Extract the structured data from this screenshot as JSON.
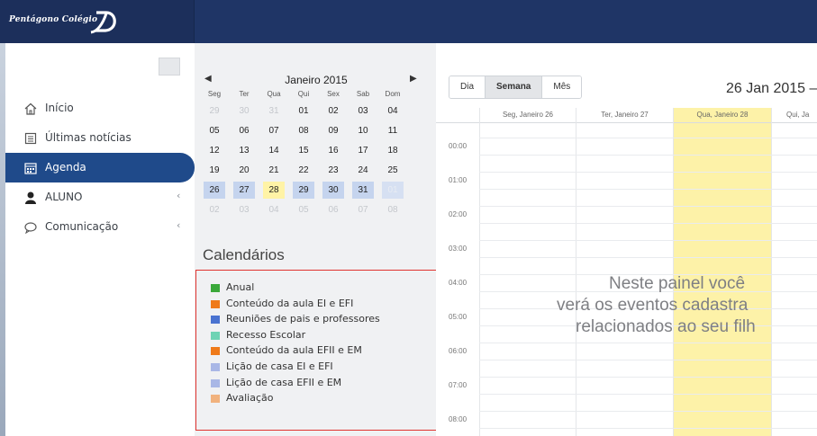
{
  "brand": {
    "name": "Pentágono Colégio"
  },
  "sidebar": {
    "items": [
      {
        "label": "Início",
        "icon": "home-icon",
        "active": false,
        "chevron": ""
      },
      {
        "label": "Últimas notícias",
        "icon": "news-icon",
        "active": false,
        "chevron": ""
      },
      {
        "label": "Agenda",
        "icon": "calendar-icon",
        "active": true,
        "chevron": ""
      },
      {
        "label": "ALUNO",
        "icon": "user-icon",
        "active": false,
        "chevron": "‹"
      },
      {
        "label": "Comunicação",
        "icon": "chat-icon",
        "active": false,
        "chevron": "‹"
      }
    ]
  },
  "mini_calendar": {
    "prev": "◀",
    "next": "▶",
    "title": "Janeiro 2015",
    "weekdays": [
      "Seg",
      "Ter",
      "Qua",
      "Qui",
      "Sex",
      "Sab",
      "Dom"
    ],
    "weeks": [
      [
        "29",
        "30",
        "31",
        "01",
        "02",
        "03",
        "04"
      ],
      [
        "05",
        "06",
        "07",
        "08",
        "09",
        "10",
        "11"
      ],
      [
        "12",
        "13",
        "14",
        "15",
        "16",
        "17",
        "18"
      ],
      [
        "19",
        "20",
        "21",
        "22",
        "23",
        "24",
        "25"
      ],
      [
        "26",
        "27",
        "28",
        "29",
        "30",
        "31",
        "01"
      ],
      [
        "02",
        "03",
        "04",
        "05",
        "06",
        "07",
        "08"
      ]
    ]
  },
  "calendars": {
    "heading": "Calendários",
    "items": [
      {
        "name": "Anual",
        "color": "#3aa83a"
      },
      {
        "name": "Conteúdo da aula EI e EFI",
        "color": "#ef7a1a"
      },
      {
        "name": "Reuniões de pais e professores",
        "color": "#4a73d1"
      },
      {
        "name": "Recesso Escolar",
        "color": "#6ed3b4"
      },
      {
        "name": "Conteúdo da aula EFII e EM",
        "color": "#ef7a1a"
      },
      {
        "name": "Lição de casa EI e EFI",
        "color": "#a9b7e6"
      },
      {
        "name": "Lição de casa EFII e EM",
        "color": "#a9b7e6"
      },
      {
        "name": "Avaliação",
        "color": "#f1b27e"
      }
    ]
  },
  "main": {
    "views": {
      "day": "Dia",
      "week": "Semana",
      "month": "Mês"
    },
    "range_title": "26 Jan 2015 –",
    "columns": [
      "Seg, Janeiro 26",
      "Ter, Janeiro 27",
      "Qua, Janeiro 28",
      "Qui, Ja"
    ],
    "hours": [
      "00:00",
      "01:00",
      "02:00",
      "03:00",
      "04:00",
      "05:00",
      "06:00",
      "07:00",
      "08:00"
    ],
    "overlay": [
      "Neste painel você",
      "verá os eventos cadastra",
      "relacionados ao seu filh"
    ]
  }
}
